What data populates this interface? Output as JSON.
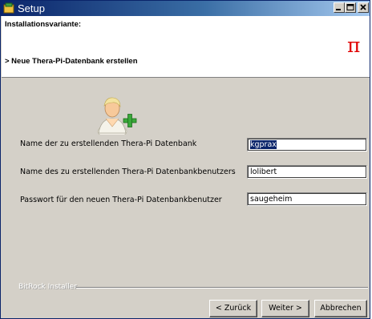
{
  "background": {
    "fragment_1": "er",
    "fragment_2": "."
  },
  "window": {
    "title": "Setup",
    "controls": [
      "minimize",
      "maximize",
      "close"
    ]
  },
  "header": {
    "heading": "Installationsvariante:",
    "subheading": "> Neue Thera-Pi-Datenbank erstellen",
    "logo_symbol": "π"
  },
  "icon": "user-add-icon",
  "form": {
    "rows": [
      {
        "label": "Name der zu erstellenden Thera-Pi  Datenbank",
        "value": "kgprax",
        "selected": true
      },
      {
        "label": "Name des zu erstellenden Thera-Pi  Datenbankbenutzers",
        "value": "lolibert"
      },
      {
        "label": "Passwort für den neuen Thera-Pi Datenbankbenutzer",
        "value": "saugeheim"
      }
    ]
  },
  "footer": {
    "installer_label": "BitRock Installer",
    "back_label": "< Zurück",
    "next_label": "Weiter >",
    "cancel_label": "Abbrechen"
  },
  "colors": {
    "titlebar": "#0a246a",
    "logo": "#e00000",
    "dialog": "#d4d0c8"
  }
}
